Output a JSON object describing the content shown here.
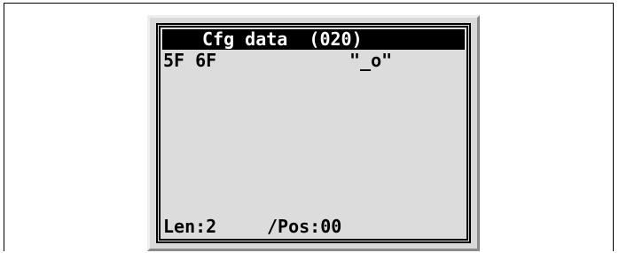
{
  "screen": {
    "title": "Cfg data  (020)",
    "rows": [
      {
        "hex": "5F 6F",
        "ascii": "\"_o\""
      }
    ],
    "status": {
      "len": "Len:2",
      "pos": "/Pos:00"
    }
  },
  "colors": {
    "title_background": "#000000",
    "title_text": "#ffffff",
    "screen_background": "#dcdcdc",
    "bezel": "#d9d9d9"
  }
}
